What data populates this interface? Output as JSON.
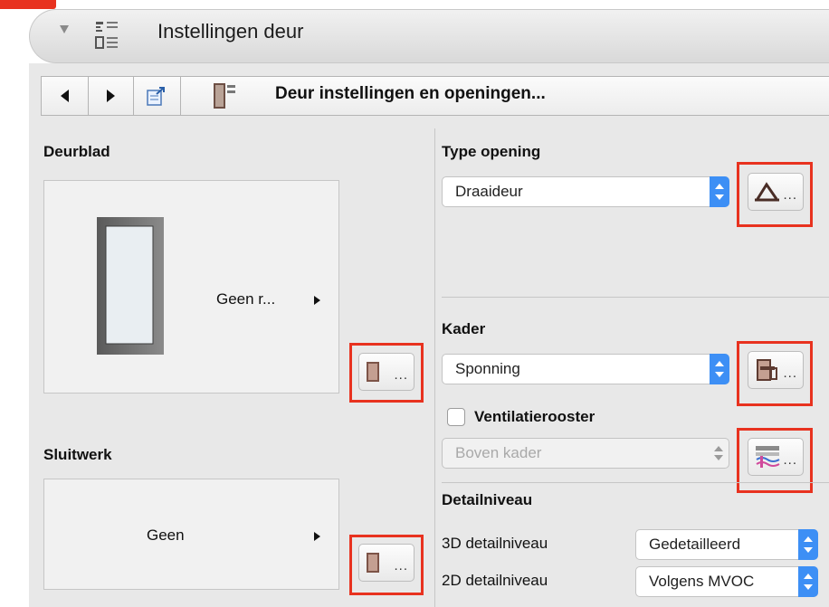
{
  "title": "Instellingen deur",
  "toolbar": {
    "label": "Deur instellingen en openingen..."
  },
  "deurblad": {
    "heading": "Deurblad",
    "value": "Geen r...",
    "button_dots": "..."
  },
  "sluitwerk": {
    "heading": "Sluitwerk",
    "value": "Geen",
    "button_dots": "..."
  },
  "type_opening": {
    "heading": "Type opening",
    "selected": "Draaideur",
    "button_dots": "..."
  },
  "kader": {
    "heading": "Kader",
    "selected": "Sponning",
    "button_dots": "..."
  },
  "ventilatie": {
    "label": "Ventilatierooster",
    "checked": false,
    "selected": "Boven kader",
    "button_dots": "..."
  },
  "detailniveau": {
    "heading": "Detailniveau",
    "rows": [
      {
        "label": "3D detailniveau",
        "value": "Gedetailleerd"
      },
      {
        "label": "2D detailniveau",
        "value": "Volgens MVOC"
      }
    ]
  },
  "colors": {
    "annotation": "#e8321f",
    "accent": "#3d8ff5"
  }
}
